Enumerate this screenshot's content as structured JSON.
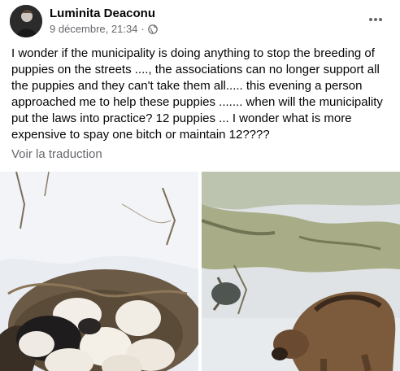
{
  "post": {
    "author": "Luminita Deaconu",
    "timestamp": "9 décembre, 21:34",
    "separator": "·",
    "privacy_icon": "globe-icon",
    "more_icon": "more-horizontal-icon",
    "text": "I wonder if the municipality is doing anything to stop the breeding of puppies on the streets ...., the associations can no longer support all the puppies and they can't take them all..... this evening a person approached me to help these puppies ....... when will the municipality put the laws into practice? 12 puppies ... I wonder what is more expensive to spay one bitch or maintain 12????",
    "translate_label": "Voir la traduction"
  },
  "colors": {
    "text": "#050505",
    "secondary": "#65676b"
  }
}
